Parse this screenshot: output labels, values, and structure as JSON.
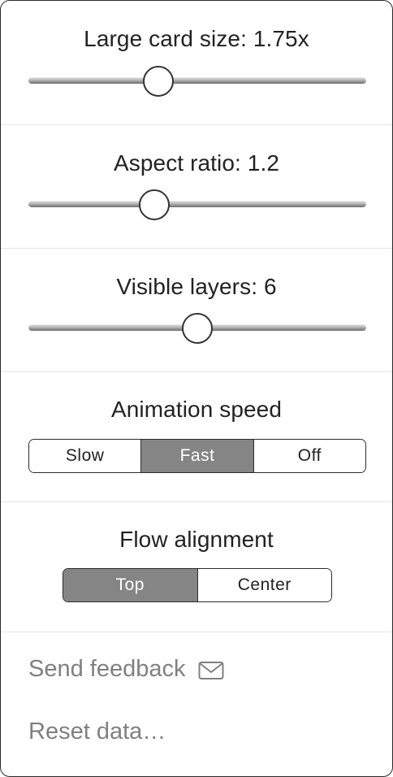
{
  "sliders": {
    "card_size": {
      "label": "Large card size: 1.75x",
      "position_fraction": 0.385
    },
    "aspect_ratio": {
      "label": "Aspect ratio: 1.2",
      "position_fraction": 0.372
    },
    "visible_layers": {
      "label": "Visible layers: 6",
      "position_fraction": 0.5
    }
  },
  "animation_speed": {
    "label": "Animation speed",
    "options": [
      "Slow",
      "Fast",
      "Off"
    ],
    "selected": "Fast"
  },
  "flow_alignment": {
    "label": "Flow alignment",
    "options": [
      "Top",
      "Center"
    ],
    "selected": "Top"
  },
  "links": {
    "send_feedback": "Send feedback",
    "reset_data": "Reset data…"
  },
  "icons": {
    "feedback": "envelope-icon"
  },
  "colors": {
    "selected_segment": "#858585",
    "link_text": "#808080"
  }
}
